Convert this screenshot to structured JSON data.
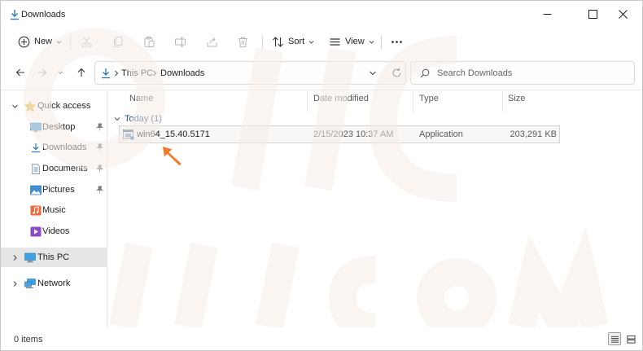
{
  "window": {
    "title": "Downloads"
  },
  "toolbar": {
    "new_label": "New",
    "sort_label": "Sort",
    "view_label": "View"
  },
  "address": {
    "crumbs": [
      "This PC",
      "Downloads"
    ]
  },
  "search": {
    "placeholder": "Search Downloads"
  },
  "sidebar": {
    "quick_access": "Quick access",
    "items": [
      {
        "label": "Desktop",
        "icon": "desktop-icon",
        "pinned": true
      },
      {
        "label": "Downloads",
        "icon": "downloads-icon",
        "pinned": true
      },
      {
        "label": "Documents",
        "icon": "documents-icon",
        "pinned": true
      },
      {
        "label": "Pictures",
        "icon": "pictures-icon",
        "pinned": true
      },
      {
        "label": "Music",
        "icon": "music-icon",
        "pinned": false
      },
      {
        "label": "Videos",
        "icon": "videos-icon",
        "pinned": false
      }
    ],
    "this_pc": "This PC",
    "network": "Network"
  },
  "columns": {
    "name": "Name",
    "date": "Date modified",
    "type": "Type",
    "size": "Size"
  },
  "group": {
    "label": "Today (1)"
  },
  "file": {
    "name": "win64_15.40.5171",
    "date": "2/15/2023 10:37 AM",
    "type": "Application",
    "size": "203,291 KB"
  },
  "status": {
    "text": "0 items"
  },
  "colors": {
    "accent": "#f07a28",
    "folder_yellow": "#f2c14e",
    "selected_bg": "#e6e6e6"
  }
}
